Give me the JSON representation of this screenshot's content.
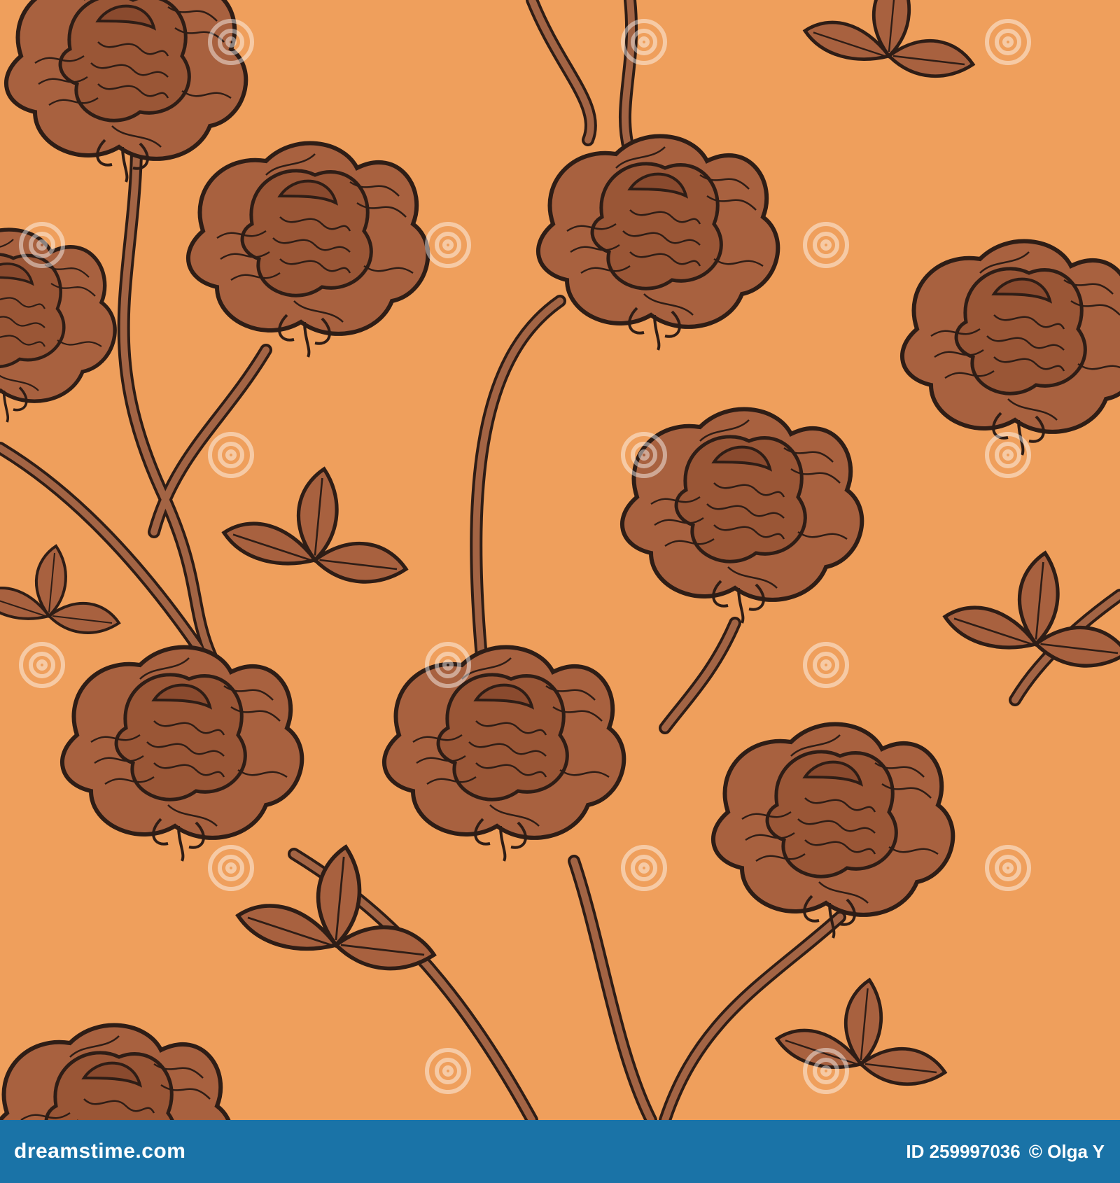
{
  "image": {
    "description_colors": {
      "background": "#ef9f5c",
      "petal_fill": "#a8613f",
      "outline": "#2e1d16",
      "stem": "#a36444",
      "footer": "#1a73a7"
    },
    "watermark_text": "dreamstime"
  },
  "footer": {
    "site": "dreamstime.com",
    "image_id": "ID 259997036",
    "author": "© Olga Y"
  }
}
